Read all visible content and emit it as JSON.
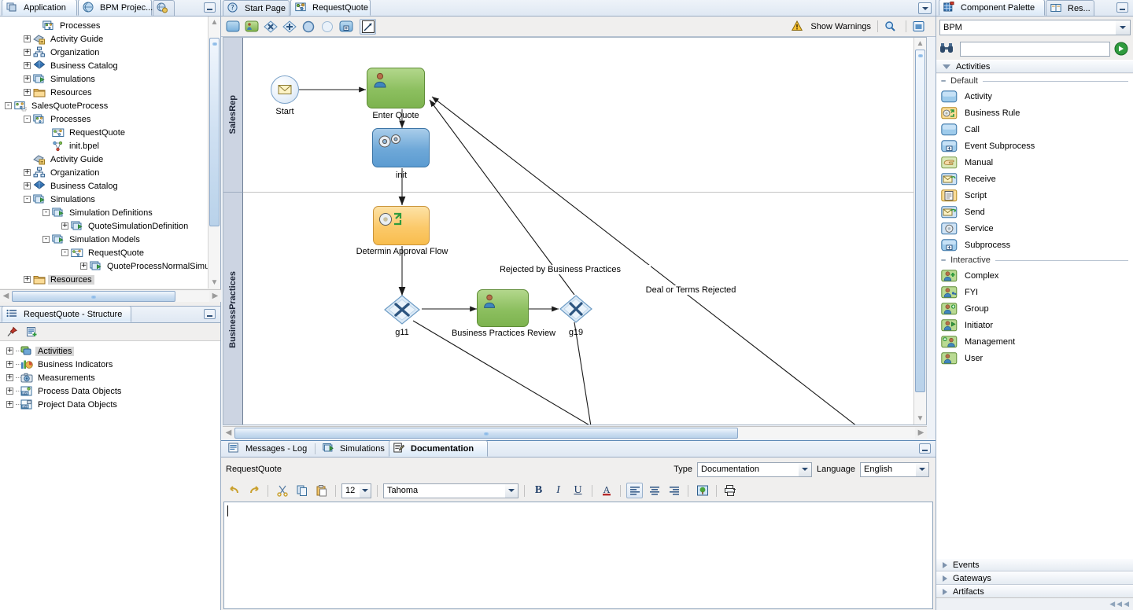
{
  "app_tabs": {
    "left": [
      {
        "label": "Application",
        "icon": "application-icon",
        "active": false
      },
      {
        "label": "BPM Projec...",
        "icon": "bpm-project-icon",
        "active": true
      },
      {
        "label": "",
        "icon": "globe-gear-icon",
        "active": false
      }
    ]
  },
  "project_tree": {
    "nodes": [
      {
        "label": "Processes",
        "indent": 3,
        "exp": "",
        "icon": "processes-icon",
        "sel": false
      },
      {
        "label": "Activity Guide",
        "indent": 2,
        "exp": "+",
        "icon": "activity-guide-icon",
        "sel": false
      },
      {
        "label": "Organization",
        "indent": 2,
        "exp": "+",
        "icon": "organization-icon",
        "sel": false
      },
      {
        "label": "Business Catalog",
        "indent": 2,
        "exp": "+",
        "icon": "catalog-icon",
        "sel": false
      },
      {
        "label": "Simulations",
        "indent": 2,
        "exp": "+",
        "icon": "simulations-icon",
        "sel": false
      },
      {
        "label": "Resources",
        "indent": 2,
        "exp": "+",
        "icon": "folder-icon",
        "sel": false
      },
      {
        "label": "SalesQuoteProcess",
        "indent": 0,
        "exp": "-",
        "icon": "process-project-icon",
        "sel": false
      },
      {
        "label": "Processes",
        "indent": 2,
        "exp": "-",
        "icon": "processes-icon",
        "sel": false
      },
      {
        "label": "RequestQuote",
        "indent": 4,
        "exp": "",
        "icon": "process-icon",
        "sel": false
      },
      {
        "label": "init.bpel",
        "indent": 4,
        "exp": "",
        "icon": "bpel-icon",
        "sel": false
      },
      {
        "label": "Activity Guide",
        "indent": 2,
        "exp": "",
        "icon": "activity-guide-icon",
        "sel": false
      },
      {
        "label": "Organization",
        "indent": 2,
        "exp": "+",
        "icon": "organization-icon",
        "sel": false
      },
      {
        "label": "Business Catalog",
        "indent": 2,
        "exp": "+",
        "icon": "catalog-icon",
        "sel": false
      },
      {
        "label": "Simulations",
        "indent": 2,
        "exp": "-",
        "icon": "simulations-icon",
        "sel": false
      },
      {
        "label": "Simulation Definitions",
        "indent": 4,
        "exp": "-",
        "icon": "simulations-icon",
        "sel": false
      },
      {
        "label": "QuoteSimulationDefinition",
        "indent": 6,
        "exp": "+",
        "icon": "simulations-icon",
        "sel": false
      },
      {
        "label": "Simulation Models",
        "indent": 4,
        "exp": "-",
        "icon": "simulations-icon",
        "sel": false
      },
      {
        "label": "RequestQuote",
        "indent": 6,
        "exp": "-",
        "icon": "process-icon",
        "sel": false
      },
      {
        "label": "QuoteProcessNormalSimulati",
        "indent": 8,
        "exp": "+",
        "icon": "simulations-icon",
        "sel": false
      },
      {
        "label": "Resources",
        "indent": 2,
        "exp": "+",
        "icon": "folder-icon",
        "sel": true
      }
    ]
  },
  "structure_panel": {
    "tab_label": "RequestQuote - Structure",
    "toolbar": [
      {
        "name": "pin-icon"
      },
      {
        "name": "new-structure-icon"
      }
    ],
    "nodes": [
      {
        "label": "Activities",
        "icon": "activities-icon",
        "sel": true
      },
      {
        "label": "Business Indicators",
        "icon": "business-indicators-icon",
        "sel": false
      },
      {
        "label": "Measurements",
        "icon": "measurements-icon",
        "sel": false
      },
      {
        "label": "Process Data Objects",
        "icon": "process-data-objects-icon",
        "sel": false
      },
      {
        "label": "Project Data Objects",
        "icon": "project-data-objects-icon",
        "sel": false
      }
    ]
  },
  "editor": {
    "tabs": [
      {
        "label": "Start Page",
        "icon": "help-circle-icon",
        "active": false
      },
      {
        "label": "RequestQuote",
        "icon": "process-icon",
        "active": true
      }
    ],
    "toolbar": {
      "buttons": [
        {
          "name": "activity-tool",
          "icon": "rounded-rect-blue"
        },
        {
          "name": "user-task-tool",
          "icon": "rounded-rect-green-user"
        },
        {
          "name": "exclusive-gateway-tool",
          "icon": "diamond-x"
        },
        {
          "name": "inclusive-gateway-tool",
          "icon": "diamond-plus"
        },
        {
          "name": "event-tool",
          "icon": "circle-filled"
        },
        {
          "name": "end-event-tool",
          "icon": "circle-light"
        },
        {
          "name": "subprocess-tool",
          "icon": "subprocess-square"
        },
        {
          "name": "sequence-flow-tool",
          "icon": "arrow-diagonal"
        }
      ],
      "show_warnings": "Show Warnings",
      "warning_icon": "warning-triangle-icon",
      "search_icon": "magnifier-icon",
      "view_icon": "view-window-icon"
    }
  },
  "diagram": {
    "lanes": [
      {
        "label": "SalesRep"
      },
      {
        "label": "BusinessPractices"
      }
    ],
    "nodes": [
      {
        "id": "start",
        "label": "Start",
        "type": "start-event"
      },
      {
        "id": "t1",
        "label": "Enter Quote",
        "type": "user-task"
      },
      {
        "id": "t2",
        "label": "init",
        "type": "service-task"
      },
      {
        "id": "t3",
        "label": "Determin Approval Flow",
        "type": "business-rule-task"
      },
      {
        "id": "g11",
        "label": "g11",
        "type": "exclusive-gateway"
      },
      {
        "id": "t4",
        "label": "Business Practices Review",
        "type": "user-task"
      },
      {
        "id": "g19",
        "label": "g19",
        "type": "exclusive-gateway"
      }
    ],
    "flow_labels": [
      {
        "text": "Rejected by Business Practices"
      },
      {
        "text": "Deal or Terms Rejected"
      }
    ]
  },
  "palette": {
    "tabs": [
      {
        "label": "Component Palette",
        "icon": "palette-icon",
        "active": true
      },
      {
        "label": "Res...",
        "icon": "resources-icon",
        "active": false
      }
    ],
    "selector_value": "BPM",
    "search_value": "",
    "search_icon": "binoculars-icon",
    "go_icon": "go-arrow-icon",
    "group_activities": "Activities",
    "sections": [
      {
        "title": "Default",
        "items": [
          {
            "label": "Activity",
            "icon": "activity-icon"
          },
          {
            "label": "Business Rule",
            "icon": "business-rule-icon"
          },
          {
            "label": "Call",
            "icon": "call-icon"
          },
          {
            "label": "Event Subprocess",
            "icon": "event-subprocess-icon"
          },
          {
            "label": "Manual",
            "icon": "manual-icon"
          },
          {
            "label": "Receive",
            "icon": "receive-icon"
          },
          {
            "label": "Script",
            "icon": "script-icon"
          },
          {
            "label": "Send",
            "icon": "send-icon"
          },
          {
            "label": "Service",
            "icon": "service-icon"
          },
          {
            "label": "Subprocess",
            "icon": "subprocess-icon"
          }
        ]
      },
      {
        "title": "Interactive",
        "items": [
          {
            "label": "Complex",
            "icon": "complex-icon"
          },
          {
            "label": "FYI",
            "icon": "fyi-icon"
          },
          {
            "label": "Group",
            "icon": "group-icon"
          },
          {
            "label": "Initiator",
            "icon": "initiator-icon"
          },
          {
            "label": "Management",
            "icon": "management-icon"
          },
          {
            "label": "User",
            "icon": "user-icon"
          }
        ]
      }
    ],
    "collapsed_groups": [
      {
        "label": "Events"
      },
      {
        "label": "Gateways"
      },
      {
        "label": "Artifacts"
      }
    ]
  },
  "bottom": {
    "tabs": [
      {
        "label": "Messages - Log",
        "icon": "messages-log-icon",
        "active": false
      },
      {
        "label": "Simulations",
        "icon": "simulations-icon",
        "active": false
      },
      {
        "label": "Documentation",
        "icon": "documentation-icon",
        "active": true
      }
    ],
    "subject": "RequestQuote",
    "type_label": "Type",
    "type_value": "Documentation",
    "language_label": "Language",
    "language_value": "English",
    "font_size_value": "12",
    "font_family_value": "Tahoma",
    "editor_text": "",
    "format_buttons": [
      {
        "name": "undo-button",
        "glyph": "↶"
      },
      {
        "name": "redo-button",
        "glyph": "↷"
      },
      {
        "name": "cut-button",
        "glyph": "✂"
      },
      {
        "name": "copy-button",
        "glyph": "❐"
      },
      {
        "name": "paste-button",
        "glyph": "📋"
      },
      {
        "name": "bold-button",
        "glyph": "B"
      },
      {
        "name": "italic-button",
        "glyph": "I"
      },
      {
        "name": "underline-button",
        "glyph": "U"
      },
      {
        "name": "font-color-button",
        "glyph": "A"
      },
      {
        "name": "align-left-button",
        "glyph": "≡"
      },
      {
        "name": "align-center-button",
        "glyph": "≡"
      },
      {
        "name": "align-right-button",
        "glyph": "≡"
      },
      {
        "name": "insert-image-button",
        "glyph": "🖼"
      },
      {
        "name": "print-button",
        "glyph": "🖨"
      }
    ]
  },
  "colors": {
    "accent": "#3b74a5",
    "panel_bg": "#f0efee",
    "lane_header": "#ccd4e2",
    "task_green": "#8cbf5f",
    "task_blue": "#6ea8d8",
    "task_amber": "#fbc96a"
  }
}
